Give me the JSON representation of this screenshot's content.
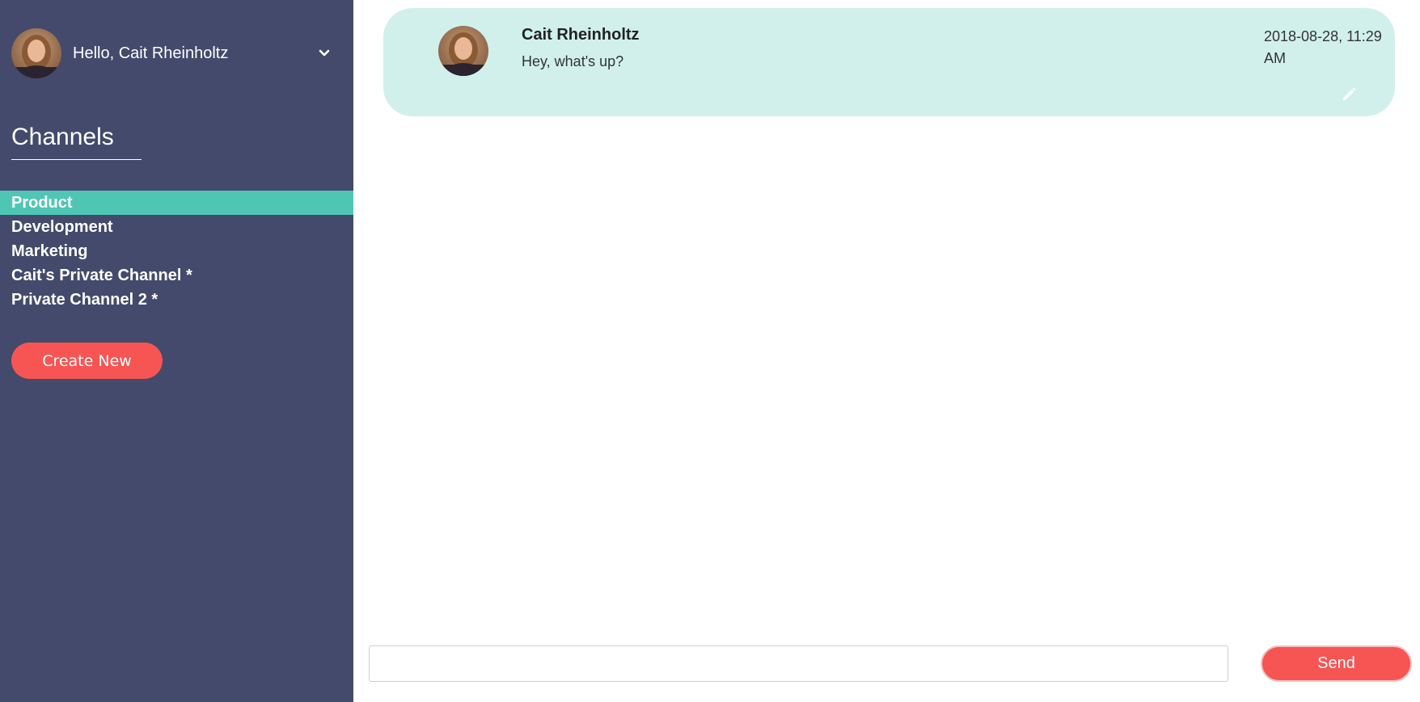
{
  "user": {
    "greeting": "Hello, Cait Rheinholtz",
    "avatar_icon": "user-avatar"
  },
  "sidebar": {
    "title": "Channels",
    "channels": [
      {
        "label": "Product",
        "active": true
      },
      {
        "label": "Development",
        "active": false
      },
      {
        "label": "Marketing",
        "active": false
      },
      {
        "label": "Cait's Private Channel *",
        "active": false
      },
      {
        "label": "Private Channel 2 *",
        "active": false
      }
    ],
    "create_label": "Create New"
  },
  "messages": [
    {
      "author": "Cait Rheinholtz",
      "text": "Hey, what's up?",
      "timestamp": "2018-08-28, 11:29 AM",
      "edit_icon": "pencil-icon"
    }
  ],
  "composer": {
    "value": "",
    "placeholder": "",
    "send_label": "Send"
  },
  "colors": {
    "sidebar_bg": "#434a6b",
    "active_channel": "#4fc6b4",
    "accent_button": "#f65553",
    "message_bg": "#d1f0ec"
  }
}
